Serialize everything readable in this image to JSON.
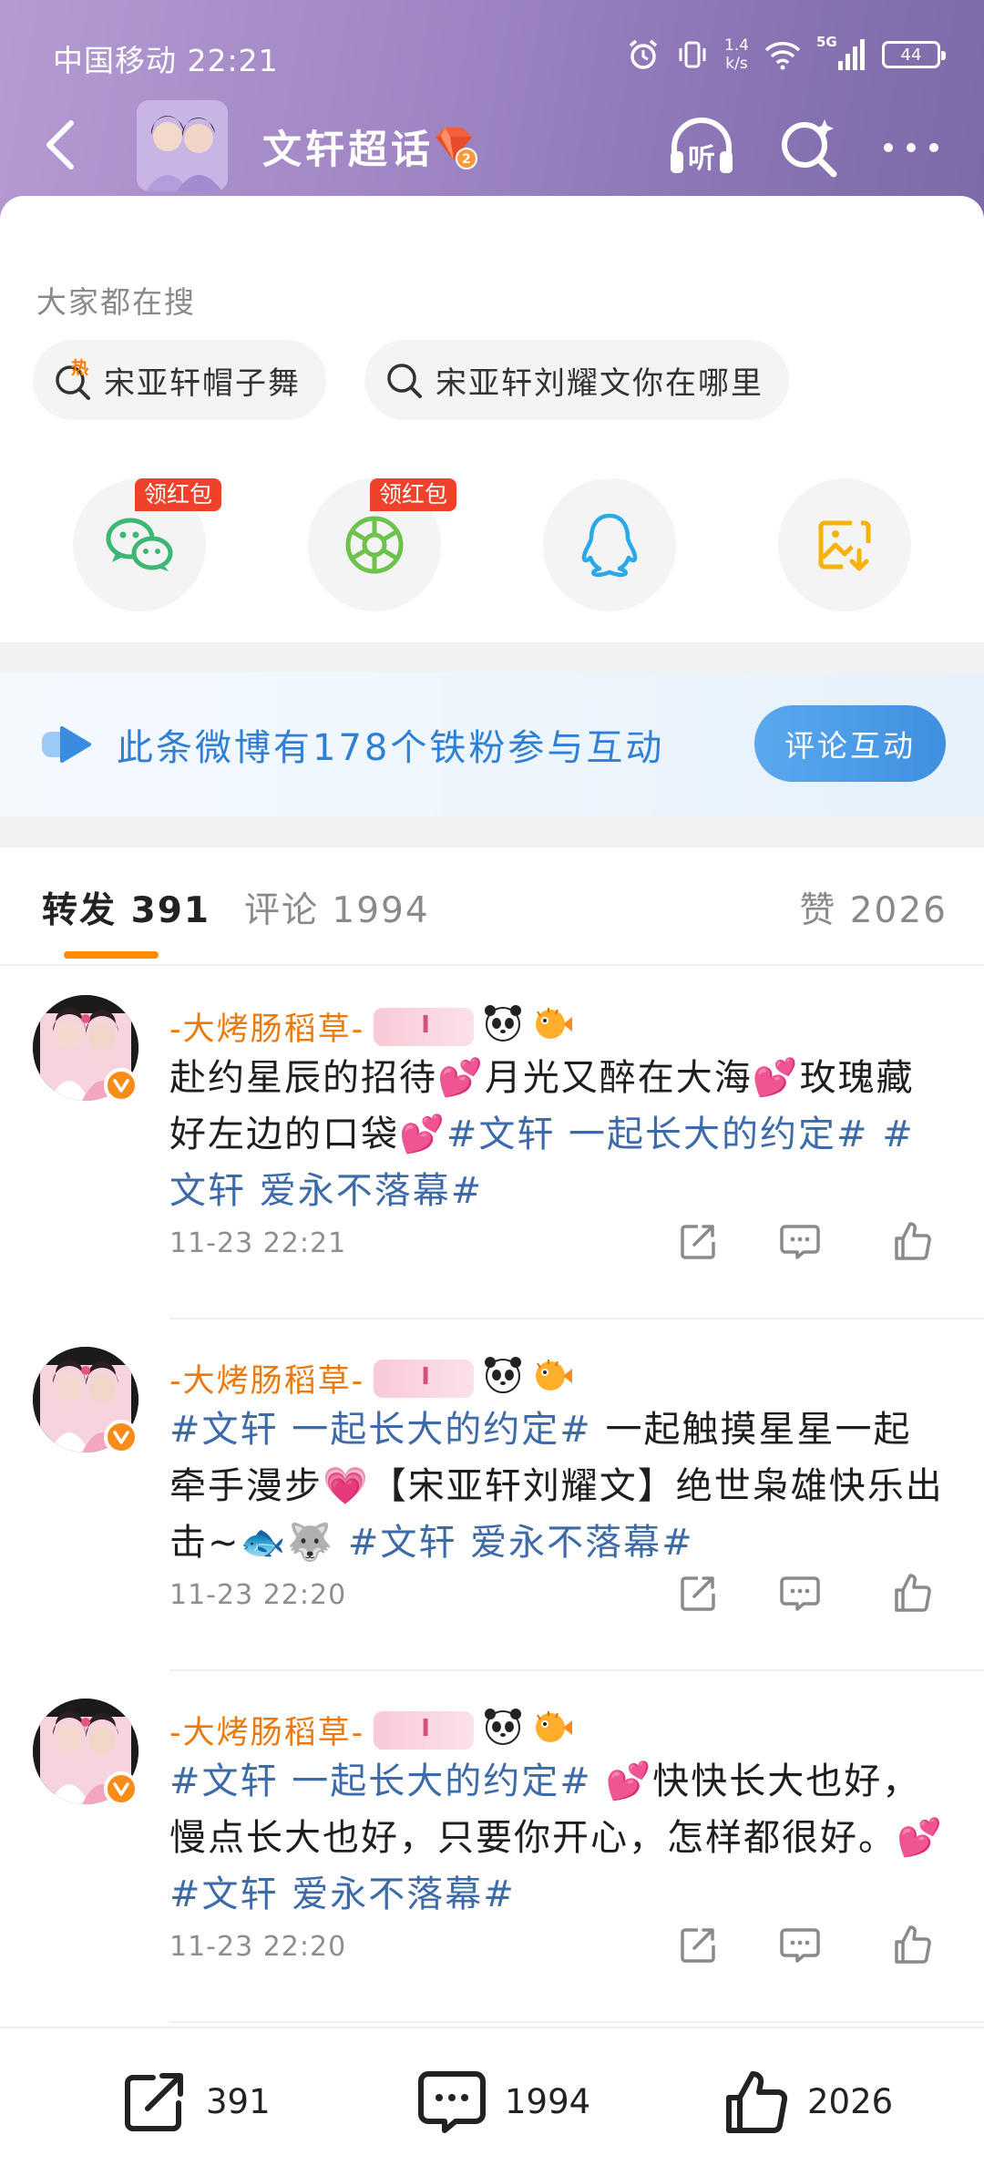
{
  "status_bar": {
    "carrier_time": "中国移动 22:21",
    "net_speed_value": "1.4",
    "net_speed_unit": "k/s",
    "signal_label": "5G",
    "battery": "44"
  },
  "nav": {
    "title": "文轩超话",
    "badge_level": "2",
    "listen_label": "听"
  },
  "search": {
    "hint": "大家都在搜",
    "chips": [
      {
        "label": "宋亚轩帽子舞",
        "hot_label": "热"
      },
      {
        "label": "宋亚轩刘耀文你在哪里"
      }
    ]
  },
  "share": {
    "redpacket_label": "领红包",
    "targets": [
      "wechat-icon",
      "moments-icon",
      "qq-icon",
      "save-image-icon"
    ]
  },
  "fan_banner": {
    "text": "此条微博有178个铁粉参与互动",
    "button": "评论互动"
  },
  "tabs": {
    "reposts": "转发 391",
    "comments": "评论 1994",
    "likes": "赞 2026"
  },
  "posts": [
    {
      "user": "-大烤肠稻草-",
      "segments": [
        "赴约星辰的招待",
        "💕",
        "月光又醉在大海",
        "💕",
        "玫瑰藏好左边的口袋",
        "💕",
        "#文轩 一起长大的约定#",
        " ",
        "#文轩 爱永不落幕#"
      ],
      "time": "11-23 22:21"
    },
    {
      "user": "-大烤肠稻草-",
      "segments": [
        "#文轩 一起长大的约定#",
        " 一起触摸星星一起牵手漫步",
        "💗",
        "【宋亚轩刘耀文】绝世枭雄快乐出击~",
        "🐟🐺",
        " ",
        "#文轩 爱永不落幕#"
      ],
      "time": "11-23 22:20"
    },
    {
      "user": "-大烤肠稻草-",
      "segments": [
        "#文轩 一起长大的约定#",
        " ",
        "💕",
        "快快长大也好，慢点长大也好，只要你开心，怎样都很好。",
        "💕",
        "#文轩 爱永不落幕#"
      ],
      "time": "11-23 22:20"
    }
  ],
  "bottom_bar": {
    "repost_count": "391",
    "comment_count": "1994",
    "like_count": "2026"
  },
  "colors": {
    "accent_orange": "#ff8a00",
    "username_orange": "#ea7a10",
    "topic_blue": "#3d6aa8",
    "banner_blue": "#2f7fd4",
    "redpacket_red": "#f0412a"
  }
}
